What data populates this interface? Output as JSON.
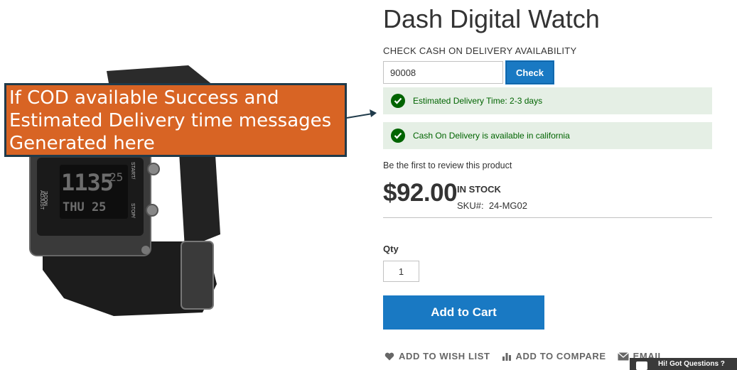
{
  "annotation": {
    "text": "If COD available Success and Estimated Delivery time messages Generated here"
  },
  "product": {
    "title": "Dash Digital Watch",
    "price": "$92.00",
    "stock": "IN STOCK",
    "sku_label": "SKU#:",
    "sku_value": "24-MG02",
    "review_link": "Be the first to review this product",
    "watch_face": {
      "time": "1135",
      "seconds": "25",
      "day": "THU 25",
      "side_left": "ADJUST",
      "side_left2": "MODE",
      "side_right": "START/",
      "side_right2": "STOP/"
    }
  },
  "cod": {
    "label": "CHECK CASH ON DELIVERY AVAILABILITY",
    "pincode_value": "90008",
    "check_label": "Check",
    "messages": [
      "Estimated Delivery Time: 2-3 days",
      "Cash On Delivery is available in california"
    ],
    "success_color": "#006400",
    "message_bg": "#e5efe5"
  },
  "purchase": {
    "qty_label": "Qty",
    "qty_value": "1",
    "add_to_cart_label": "Add to Cart",
    "accent_color": "#1979c3"
  },
  "actions": {
    "wishlist": "ADD TO WISH LIST",
    "compare": "ADD TO COMPARE",
    "email": "EMAIL"
  },
  "chat": {
    "label": "Hi! Got Questions ?"
  }
}
